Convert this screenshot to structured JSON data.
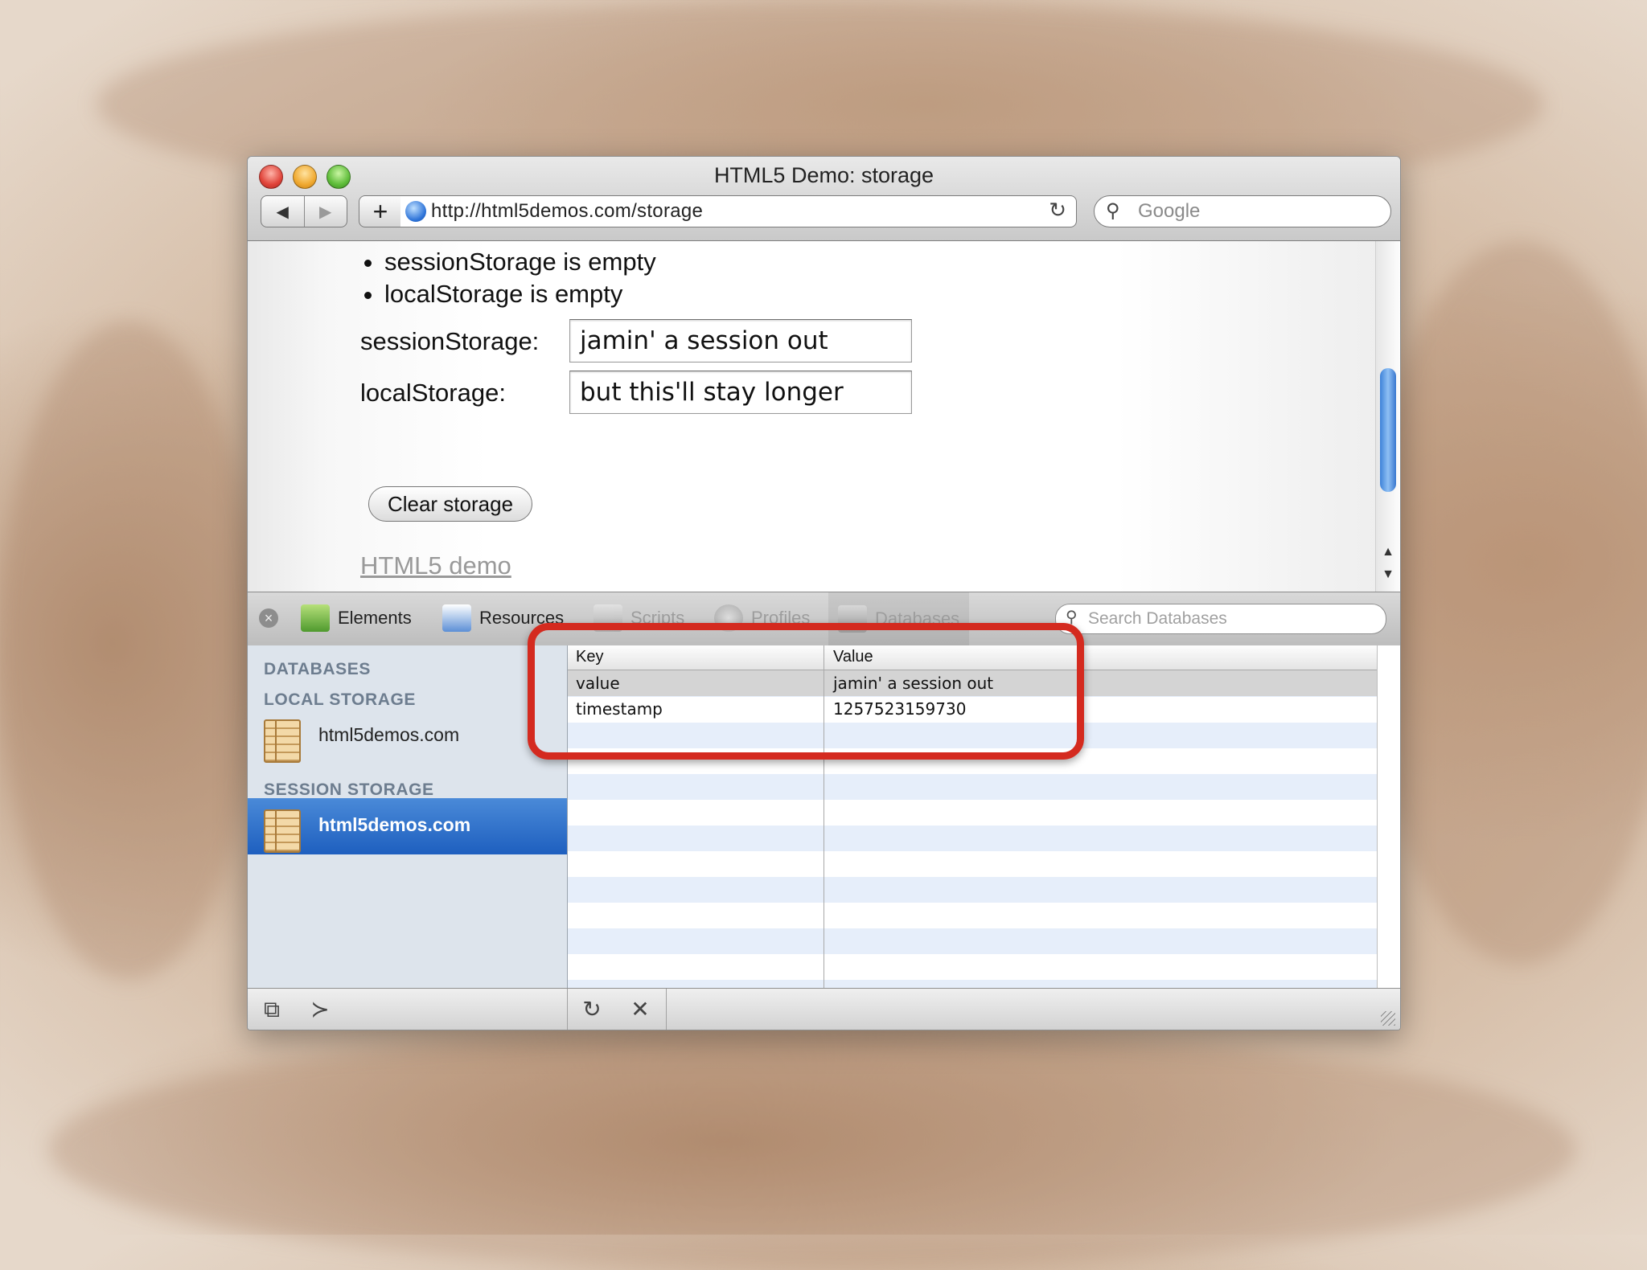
{
  "window": {
    "title": "HTML5 Demo: storage"
  },
  "toolbar": {
    "back_glyph": "◀",
    "forward_glyph": "▶",
    "add_glyph": "+",
    "url": "http://html5demos.com/storage",
    "reload_glyph": "↻",
    "search_placeholder": "Google"
  },
  "page": {
    "bullets": [
      "sessionStorage is empty",
      "localStorage is empty"
    ],
    "session_label": "sessionStorage:",
    "session_value": "jamin' a session out",
    "local_label": "localStorage:",
    "local_value": "but this'll stay longer",
    "clear_button": "Clear storage",
    "demo_link": "HTML5 demo"
  },
  "inspector": {
    "tabs": [
      "Elements",
      "Resources",
      "Scripts",
      "Profiles",
      "Databases"
    ],
    "search_placeholder": "Search Databases",
    "sidebar": {
      "databases_heading": "DATABASES",
      "local_heading": "LOCAL STORAGE",
      "local_item": "html5demos.com",
      "session_heading": "SESSION STORAGE",
      "session_item": "html5demos.com"
    },
    "grid": {
      "columns": [
        "Key",
        "Value"
      ],
      "rows": [
        {
          "key": "value",
          "value": "jamin' a session out"
        },
        {
          "key": "timestamp",
          "value": "1257523159730"
        }
      ]
    }
  },
  "colors": {
    "highlight": "#d42a1f",
    "selection": "#1e5fbf"
  },
  "icons": [
    "globe-icon",
    "reload-icon",
    "search-icon",
    "close-icon",
    "database-icon",
    "refresh-icon",
    "delete-icon",
    "dock-icon",
    "console-icon"
  ]
}
